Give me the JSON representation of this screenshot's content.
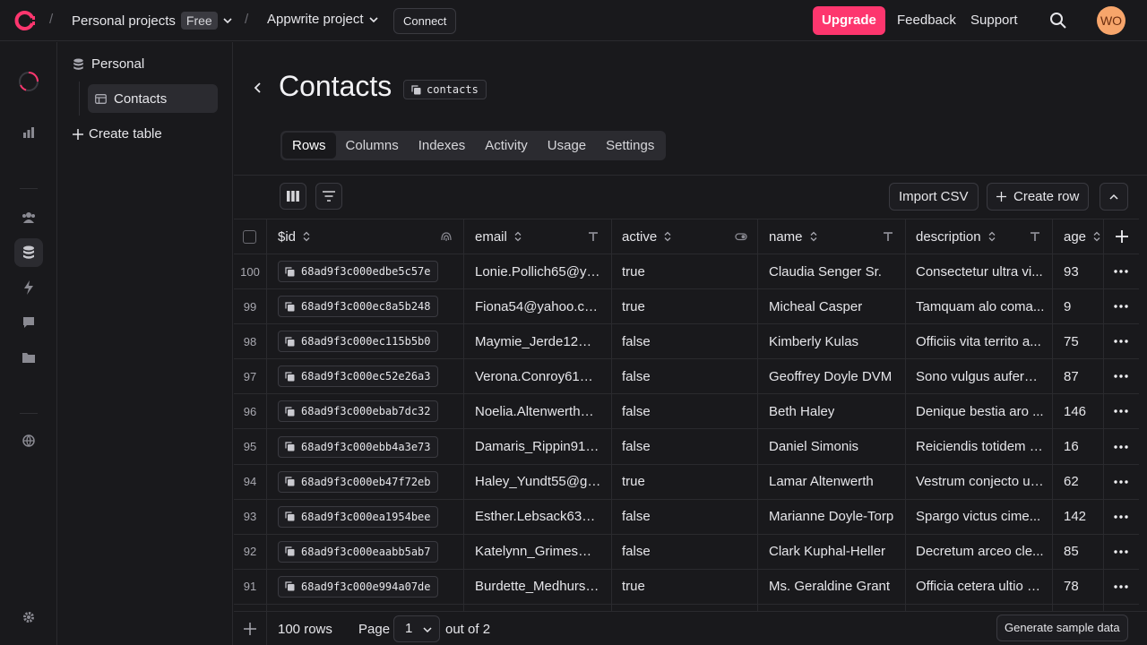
{
  "topbar": {
    "org": "Personal projects",
    "plan_badge": "Free",
    "project": "Appwrite project",
    "connect_label": "Connect",
    "upgrade_label": "Upgrade",
    "feedback_label": "Feedback",
    "support_label": "Support",
    "avatar_initials": "WO"
  },
  "sidebar": {
    "database": "Personal",
    "table": "Contacts",
    "create_table": "Create table"
  },
  "page": {
    "title": "Contacts",
    "table_id": "contacts",
    "tabs": [
      "Rows",
      "Columns",
      "Indexes",
      "Activity",
      "Usage",
      "Settings"
    ],
    "active_tab": "Rows",
    "import_csv": "Import CSV",
    "create_row": "Create row"
  },
  "table": {
    "columns": [
      "$id",
      "email",
      "active",
      "name",
      "description",
      "age"
    ],
    "rows": [
      {
        "num": "100",
        "id": "68ad9f3c000edbe5c57e",
        "email": "Lonie.Pollich65@ya...",
        "active": "true",
        "name": "Claudia Senger Sr.",
        "description": "Consectetur ultra vi...",
        "age": "93"
      },
      {
        "num": "99",
        "id": "68ad9f3c000ec8a5b248",
        "email": "Fiona54@yahoo.com",
        "active": "true",
        "name": "Micheal Casper",
        "description": "Tamquam alo coma...",
        "age": "9"
      },
      {
        "num": "98",
        "id": "68ad9f3c000ec115b5b0",
        "email": "Maymie_Jerde12@y...",
        "active": "false",
        "name": "Kimberly Kulas",
        "description": "Officiis vita territo a...",
        "age": "75"
      },
      {
        "num": "97",
        "id": "68ad9f3c000ec52e26a3",
        "email": "Verona.Conroy61@...",
        "active": "false",
        "name": "Geoffrey Doyle DVM",
        "description": "Sono vulgus aufero ...",
        "age": "87"
      },
      {
        "num": "96",
        "id": "68ad9f3c000ebab7dc32",
        "email": "Noelia.Altenwerth@...",
        "active": "false",
        "name": "Beth Haley",
        "description": "Denique bestia aro ...",
        "age": "146"
      },
      {
        "num": "95",
        "id": "68ad9f3c000ebb4a3e73",
        "email": "Damaris_Rippin91@...",
        "active": "false",
        "name": "Daniel Simonis",
        "description": "Reiciendis totidem v...",
        "age": "16"
      },
      {
        "num": "94",
        "id": "68ad9f3c000eb47f72eb",
        "email": "Haley_Yundt55@gm...",
        "active": "true",
        "name": "Lamar Altenwerth",
        "description": "Vestrum conjecto ut...",
        "age": "62"
      },
      {
        "num": "93",
        "id": "68ad9f3c000ea1954bee",
        "email": "Esther.Lebsack63@...",
        "active": "false",
        "name": "Marianne Doyle-Torp",
        "description": "Spargo victus cime...",
        "age": "142"
      },
      {
        "num": "92",
        "id": "68ad9f3c000eaabb5ab7",
        "email": "Katelynn_Grimes@h...",
        "active": "false",
        "name": "Clark Kuphal-Heller",
        "description": "Decretum arceo cle...",
        "age": "85"
      },
      {
        "num": "91",
        "id": "68ad9f3c000e994a07de",
        "email": "Burdette_Medhurst-...",
        "active": "true",
        "name": "Ms. Geraldine Grant",
        "description": "Officia cetera ultio a...",
        "age": "78"
      }
    ]
  },
  "footer": {
    "rows_count": "100 rows",
    "page_label": "Page",
    "page_value": "1",
    "out_of": "out of 2",
    "generate": "Generate sample data"
  },
  "colors": {
    "accent": "#fd366e",
    "background": "#19191c",
    "border": "#2a2a2e"
  }
}
